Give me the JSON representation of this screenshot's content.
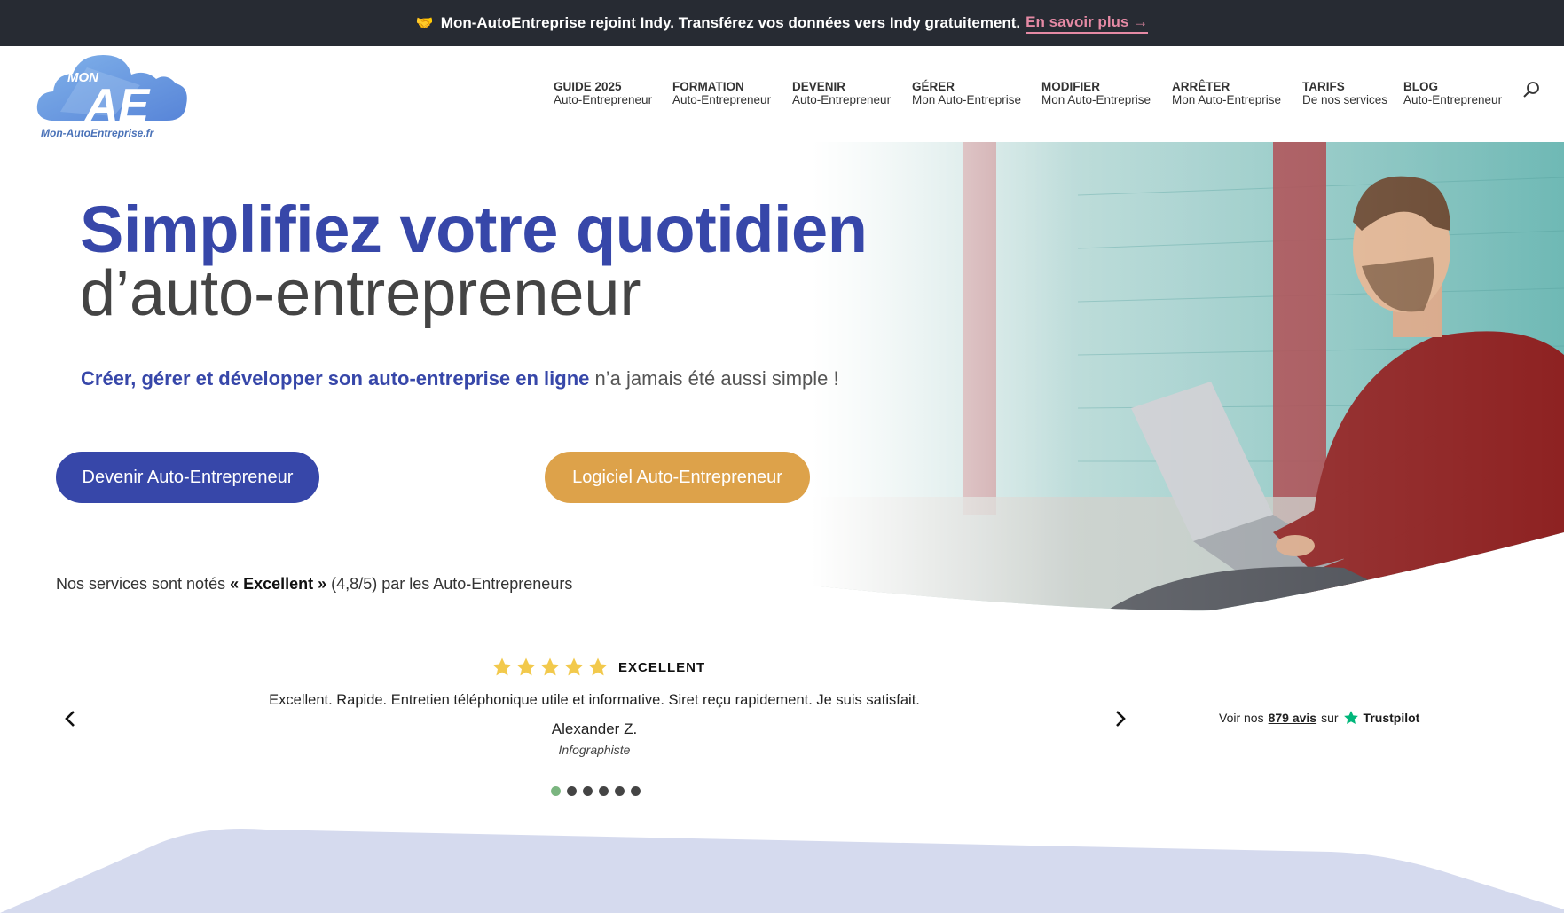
{
  "announcement": {
    "emoji": "🤝",
    "text": "Mon-AutoEntreprise rejoint Indy. Transférez vos données vers Indy gratuitement.",
    "link": "En savoir plus →"
  },
  "logo": {
    "mark": "MON",
    "letters": "AE",
    "domain": "Mon-AutoEntreprise.fr"
  },
  "nav": [
    {
      "title": "GUIDE 2025",
      "sub": "Auto-Entrepreneur"
    },
    {
      "title": "FORMATION",
      "sub": "Auto-Entrepreneur"
    },
    {
      "title": "DEVENIR",
      "sub": "Auto-Entrepreneur"
    },
    {
      "title": "GÉRER",
      "sub": "Mon Auto-Entreprise"
    },
    {
      "title": "MODIFIER",
      "sub": "Mon Auto-Entreprise"
    },
    {
      "title": "ARRÊTER",
      "sub": "Mon Auto-Entreprise"
    },
    {
      "title": "TARIFS",
      "sub": "De nos services"
    },
    {
      "title": "BLOG",
      "sub": "Auto-Entrepreneur"
    }
  ],
  "hero": {
    "headline": "Simplifiez votre quotidien",
    "subhead": "d’auto-entrepreneur",
    "tagline_strong": "Créer, gérer et développer son auto-entreprise en ligne",
    "tagline_rest": " n’a jamais été aussi simple !",
    "primary_button": "Devenir Auto-Entrepreneur",
    "secondary_button": "Logiciel Auto-Entrepreneur",
    "rating_prefix": "Nos services sont notés ",
    "rating_strong": "« Excellent »",
    "rating_suffix": " (4,8/5) par les Auto-Entrepreneurs"
  },
  "testimonial": {
    "stars": 5,
    "rating_label": "EXCELLENT",
    "quote": "Excellent. Rapide. Entretien téléphonique utile et informative. Siret reçu rapidement. Je suis satisfait.",
    "author": "Alexander Z.",
    "role": "Infographiste",
    "slides_total": 6,
    "active_slide": 1
  },
  "trustpilot": {
    "prefix": "Voir nos",
    "count": "879 avis",
    "middle": "sur",
    "brand": "Trustpilot"
  },
  "colors": {
    "brand_blue": "#3747a9",
    "brand_gold": "#dda24a",
    "topbar": "#272b33",
    "link_pink": "#e58aa5",
    "star_gold": "#f2c94c",
    "trustpilot_green": "#00b67a",
    "wave": "#d5daee"
  }
}
